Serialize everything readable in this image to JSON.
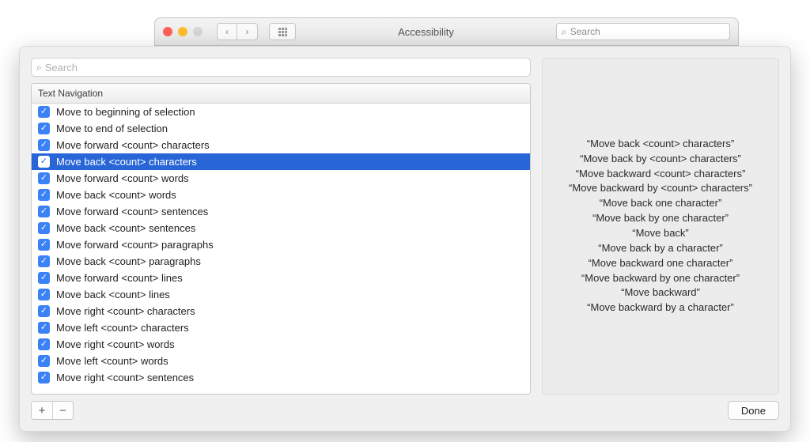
{
  "parent": {
    "title": "Accessibility",
    "search_placeholder": "Search"
  },
  "sheet": {
    "search_placeholder": "Search",
    "section_header": "Text Navigation",
    "done_label": "Done",
    "plus": "+",
    "minus": "−"
  },
  "commands": [
    {
      "label": "Move to beginning of selection",
      "selected": false
    },
    {
      "label": "Move to end of selection",
      "selected": false
    },
    {
      "label": "Move forward <count> characters",
      "selected": false
    },
    {
      "label": "Move back <count> characters",
      "selected": true
    },
    {
      "label": "Move forward <count> words",
      "selected": false
    },
    {
      "label": "Move back <count> words",
      "selected": false
    },
    {
      "label": "Move forward <count> sentences",
      "selected": false
    },
    {
      "label": "Move back <count> sentences",
      "selected": false
    },
    {
      "label": "Move forward <count> paragraphs",
      "selected": false
    },
    {
      "label": "Move back <count> paragraphs",
      "selected": false
    },
    {
      "label": "Move forward <count> lines",
      "selected": false
    },
    {
      "label": "Move back <count> lines",
      "selected": false
    },
    {
      "label": "Move right <count> characters",
      "selected": false
    },
    {
      "label": "Move left <count> characters",
      "selected": false
    },
    {
      "label": "Move right <count> words",
      "selected": false
    },
    {
      "label": "Move left <count> words",
      "selected": false
    },
    {
      "label": "Move right <count> sentences",
      "selected": false
    }
  ],
  "phrases": [
    "“Move back <count> characters”",
    "“Move back by <count> characters”",
    "“Move backward <count> characters”",
    "“Move backward by <count> characters”",
    "“Move back one character”",
    "“Move back by one character”",
    "“Move back”",
    "“Move back by a character”",
    "“Move backward one character”",
    "“Move backward by one character”",
    "“Move backward”",
    "“Move backward by a character”"
  ]
}
